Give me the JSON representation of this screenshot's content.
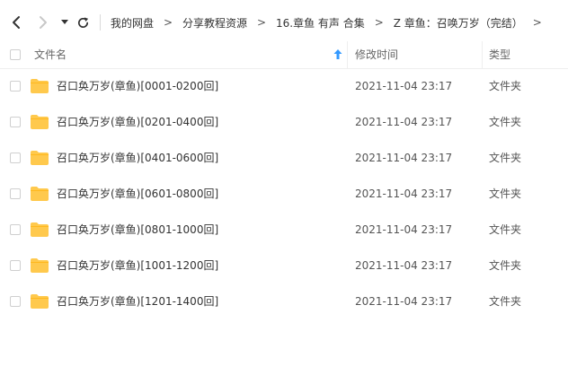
{
  "toolbar": {
    "back_icon": "chevron-left-icon",
    "forward_icon": "chevron-right-icon",
    "history_icon": "caret-down-icon",
    "refresh_icon": "refresh-icon",
    "breadcrumb": [
      "我的网盘",
      "分享教程资源",
      "16.章鱼 有声 合集",
      "Z 章鱼：召唤万岁（完结）"
    ],
    "separator": ">"
  },
  "table": {
    "headers": {
      "name": "文件名",
      "modified": "修改时间",
      "type": "类型"
    },
    "sort_icon": "sort-arrow-up-icon",
    "accent_color": "#3399ff",
    "folder_color": "#ffc94d",
    "rows": [
      {
        "name": "召口奂万岁(章鱼)[0001-0200回]",
        "modified": "2021-11-04 23:17",
        "type": "文件夹"
      },
      {
        "name": "召口奂万岁(章鱼)[0201-0400回]",
        "modified": "2021-11-04 23:17",
        "type": "文件夹"
      },
      {
        "name": "召口奂万岁(章鱼)[0401-0600回]",
        "modified": "2021-11-04 23:17",
        "type": "文件夹"
      },
      {
        "name": "召口奂万岁(章鱼)[0601-0800回]",
        "modified": "2021-11-04 23:17",
        "type": "文件夹"
      },
      {
        "name": "召口奂万岁(章鱼)[0801-1000回]",
        "modified": "2021-11-04 23:17",
        "type": "文件夹"
      },
      {
        "name": "召口奂万岁(章鱼)[1001-1200回]",
        "modified": "2021-11-04 23:17",
        "type": "文件夹"
      },
      {
        "name": "召口奂万岁(章鱼)[1201-1400回]",
        "modified": "2021-11-04 23:17",
        "type": "文件夹"
      }
    ]
  }
}
